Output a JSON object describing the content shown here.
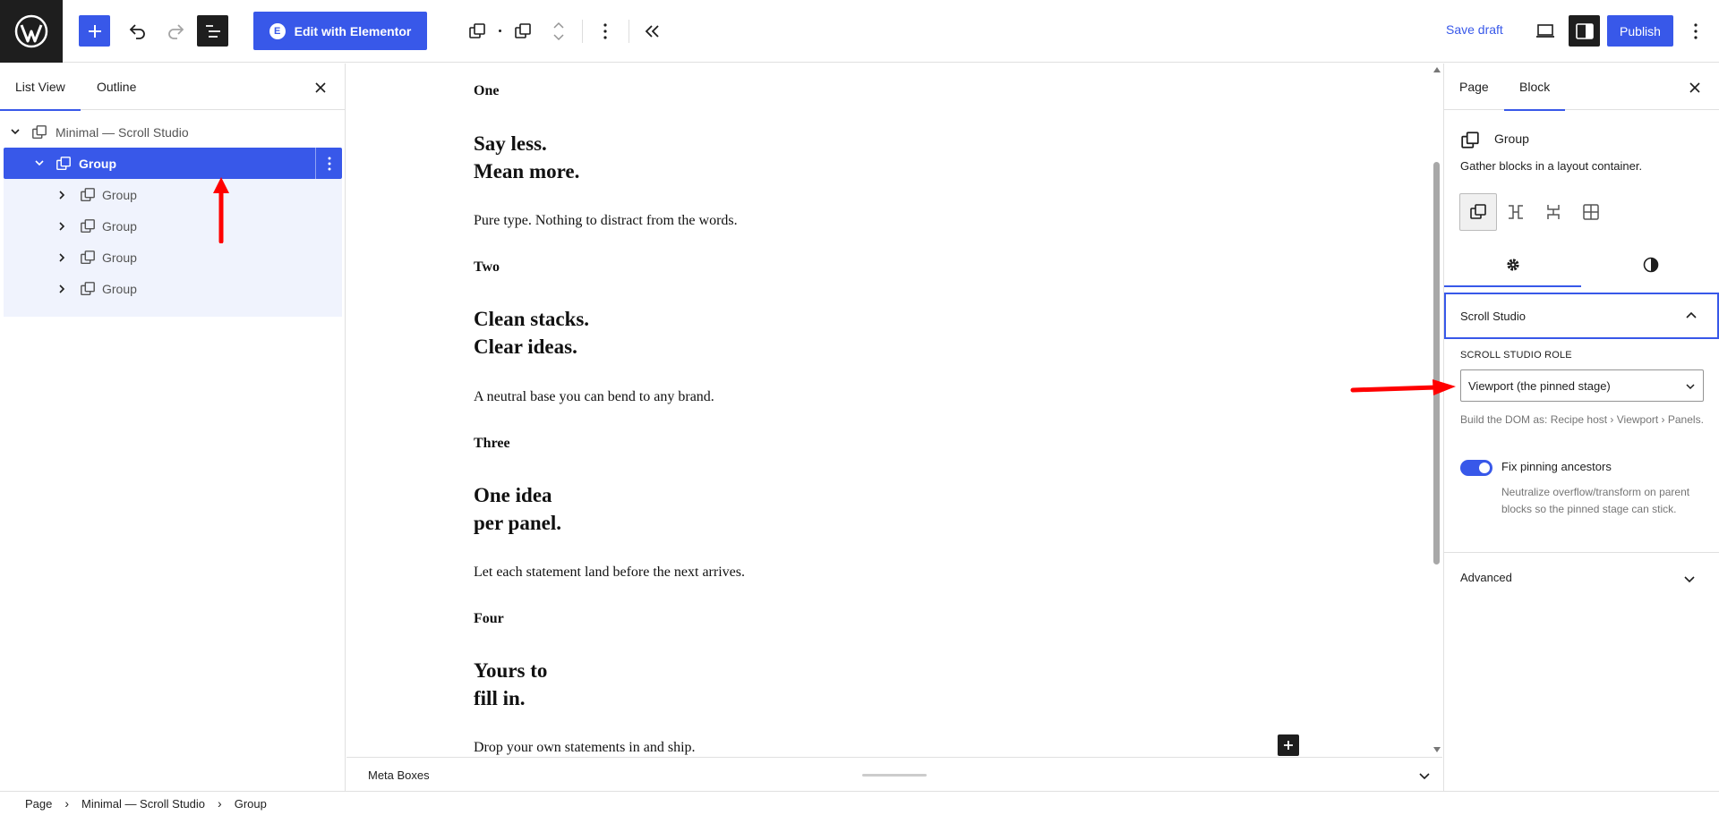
{
  "topbar": {
    "elementor_label": "Edit with Elementor",
    "elementor_badge": "E",
    "save_draft_label": "Save draft",
    "publish_label": "Publish"
  },
  "left_panel": {
    "tabs": [
      "List View",
      "Outline"
    ],
    "active_tab": "List View",
    "tree": {
      "root_label": "Minimal — Scroll Studio",
      "selected_label": "Group",
      "children": [
        "Group",
        "Group",
        "Group",
        "Group"
      ]
    }
  },
  "canvas": {
    "sections": [
      {
        "label": "One",
        "heading_lines": [
          "Say less.",
          "Mean more."
        ],
        "body": "Pure type. Nothing to distract from the words."
      },
      {
        "label": "Two",
        "heading_lines": [
          "Clean stacks.",
          "Clear ideas."
        ],
        "body": "A neutral base you can bend to any brand."
      },
      {
        "label": "Three",
        "heading_lines": [
          "One idea",
          "per panel."
        ],
        "body": "Let each statement land before the next arrives."
      },
      {
        "label": "Four",
        "heading_lines": [
          "Yours to",
          "fill in."
        ],
        "body": "Drop your own statements in and ship."
      }
    ]
  },
  "metabox": {
    "title": "Meta Boxes"
  },
  "sidebar": {
    "tabs": [
      "Page",
      "Block"
    ],
    "active_tab": "Block",
    "block_title": "Group",
    "block_description": "Gather blocks in a layout container.",
    "panel_title": "Scroll Studio",
    "role_label": "Scroll Studio Role",
    "role_value": "Viewport (the pinned stage)",
    "role_help": "Build the DOM as: Recipe host › Viewport › Panels.",
    "toggle_label": "Fix pinning ancestors",
    "toggle_on": true,
    "toggle_help": "Neutralize overflow/transform on parent blocks so the pinned stage can stick.",
    "advanced_label": "Advanced"
  },
  "footer": {
    "breadcrumbs": [
      "Page",
      "Minimal — Scroll Studio",
      "Group"
    ]
  },
  "colors": {
    "accent": "#3858e9",
    "dark": "#1e1e1e",
    "annotation": "#ff0000"
  }
}
